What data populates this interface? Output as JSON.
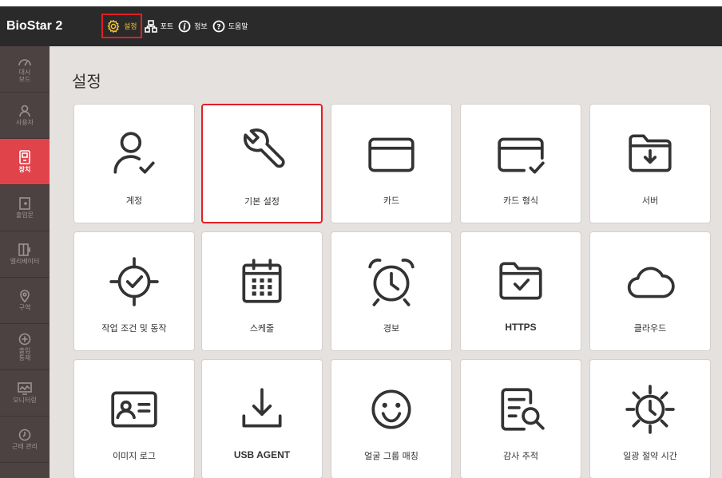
{
  "app": {
    "brand": "BioStar 2"
  },
  "topnav": {
    "settings": "설정",
    "ports": "포트",
    "info": "정보",
    "help": "도움말"
  },
  "sidebar": {
    "items": [
      {
        "label": "대시\n보드",
        "icon": "dashboard-icon"
      },
      {
        "label": "사용자",
        "icon": "user-icon"
      },
      {
        "label": "장치",
        "icon": "device-icon"
      },
      {
        "label": "출입문",
        "icon": "door-icon"
      },
      {
        "label": "엘리베이터",
        "icon": "elevator-icon"
      },
      {
        "label": "구역",
        "icon": "zone-icon"
      },
      {
        "label": "출입\n통제",
        "icon": "access-control-icon"
      },
      {
        "label": "모니터링",
        "icon": "monitoring-icon"
      },
      {
        "label": "근태 관리",
        "icon": "time-attendance-icon"
      }
    ]
  },
  "main": {
    "title": "설정",
    "tiles": [
      {
        "label": "계정",
        "icon": "account-icon"
      },
      {
        "label": "기본 설정",
        "icon": "wrench-icon"
      },
      {
        "label": "카드",
        "icon": "card-icon"
      },
      {
        "label": "카드 형식",
        "icon": "card-format-icon"
      },
      {
        "label": "서버",
        "icon": "server-folder-icon"
      },
      {
        "label": "작업 조건 및 동작",
        "icon": "trigger-action-icon"
      },
      {
        "label": "스케줄",
        "icon": "calendar-icon"
      },
      {
        "label": "경보",
        "icon": "alarm-clock-icon"
      },
      {
        "label": "HTTPS",
        "icon": "https-folder-icon"
      },
      {
        "label": "클라우드",
        "icon": "cloud-icon"
      },
      {
        "label": "이미지 로그",
        "icon": "image-log-icon"
      },
      {
        "label": "USB AGENT",
        "icon": "usb-download-icon"
      },
      {
        "label": "얼굴 그룹 매칭",
        "icon": "face-smile-icon"
      },
      {
        "label": "감사 추적",
        "icon": "audit-trail-icon"
      },
      {
        "label": "일광 절약 시간",
        "icon": "daylight-saving-icon"
      }
    ]
  },
  "colors": {
    "topbar": "#2a2a2a",
    "sidebar": "#4d4242",
    "sidebar_active": "#e1434b",
    "content_bg": "#e5e1de",
    "highlight": "#e21f26",
    "active_text": "#f1c232",
    "icon": "#333333"
  }
}
